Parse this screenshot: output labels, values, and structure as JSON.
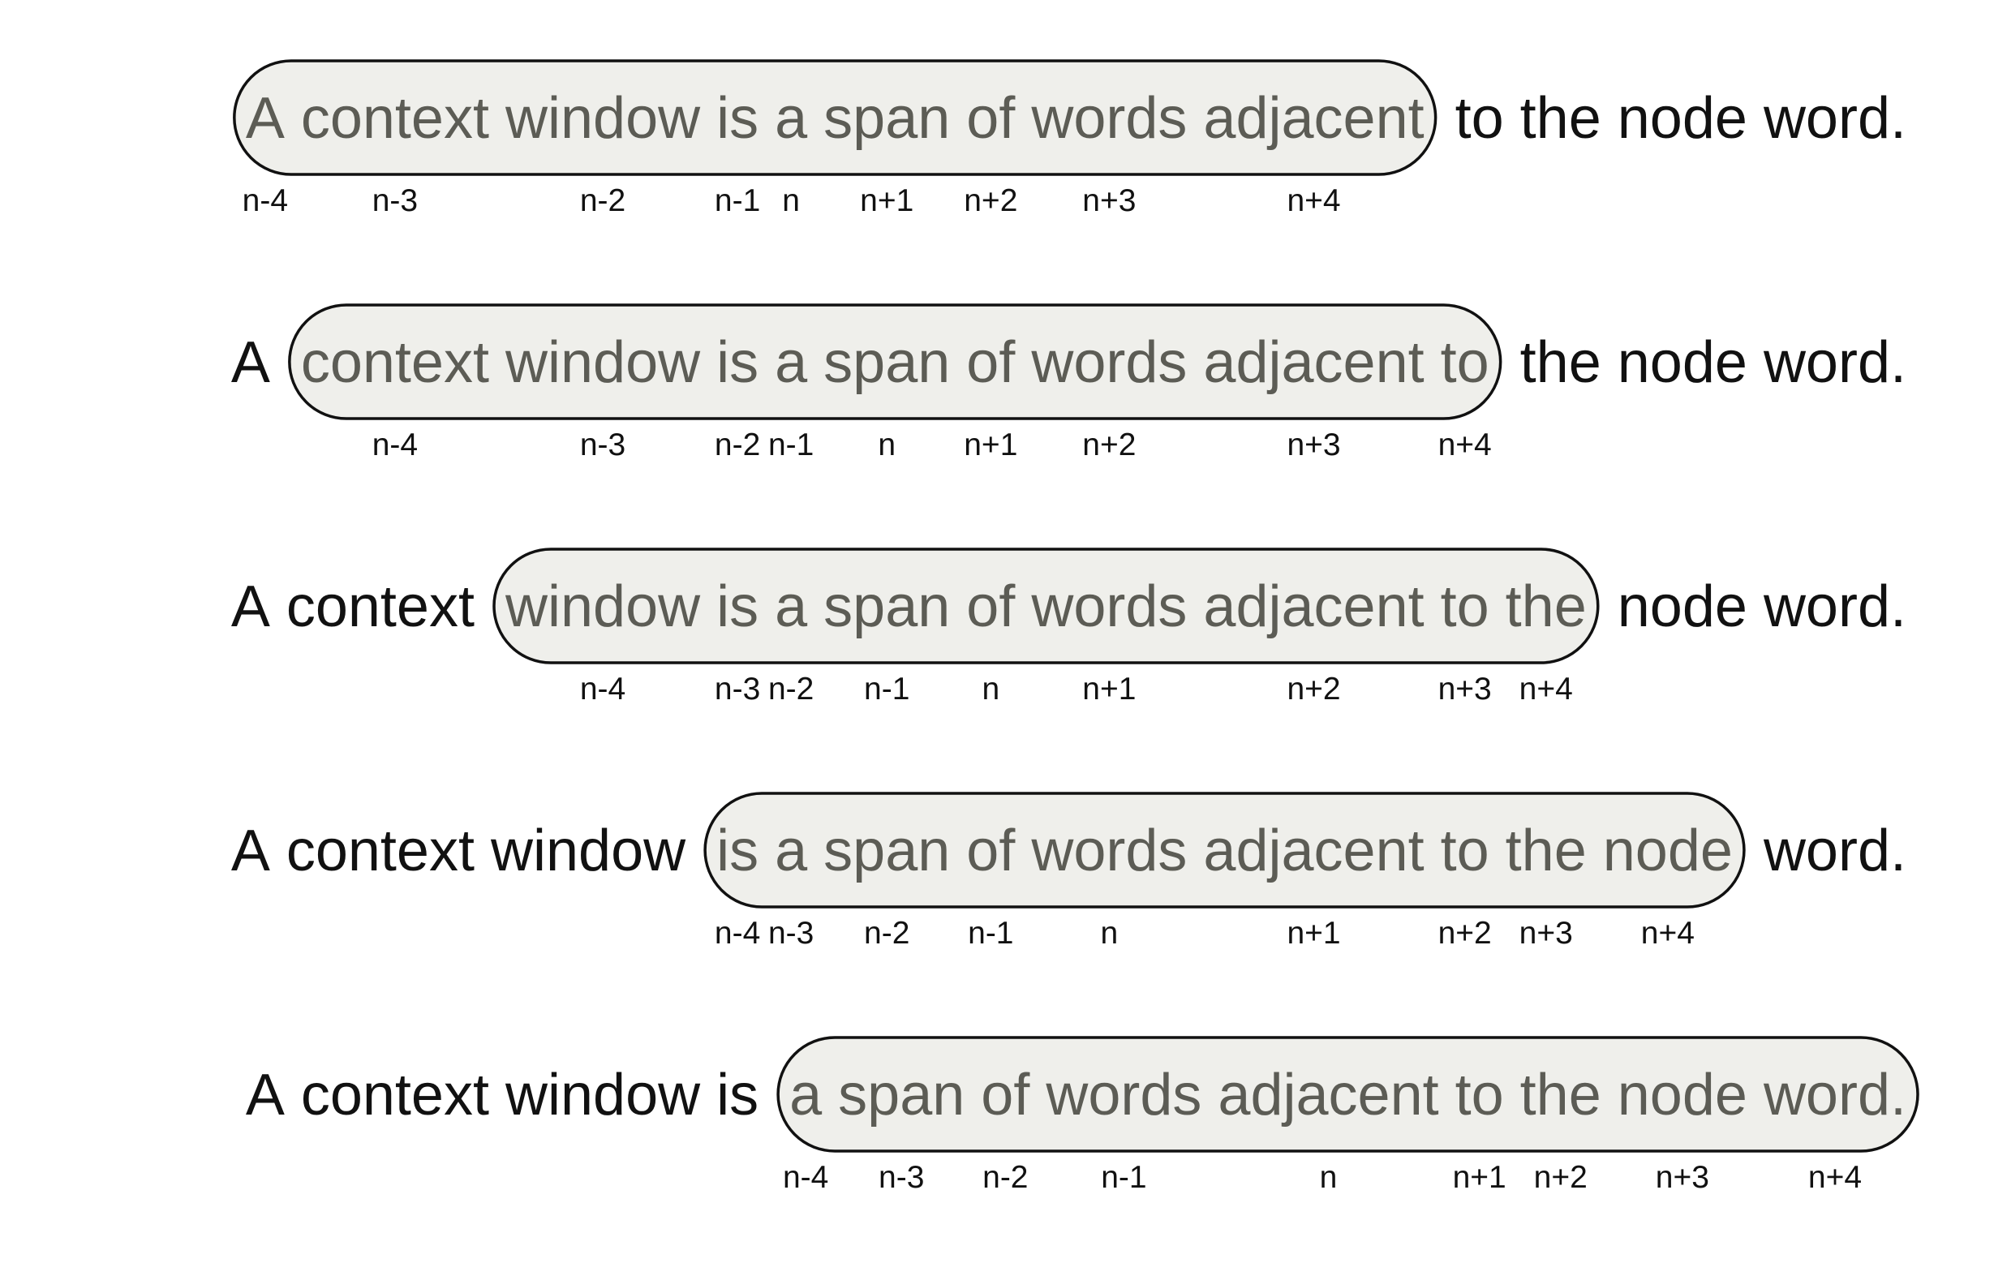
{
  "sentence": [
    "A",
    "context",
    "window",
    "is",
    "a",
    "span",
    "of",
    "words",
    "adjacent",
    "to",
    "the",
    "node",
    "word."
  ],
  "window_size": 9,
  "offset_labels": [
    "n-4",
    "n-3",
    "n-2",
    "n-1",
    "n",
    "n+1",
    "n+2",
    "n+3",
    "n+4"
  ],
  "rows": [
    {
      "window_start": 0
    },
    {
      "window_start": 1
    },
    {
      "window_start": 2
    },
    {
      "window_start": 3
    },
    {
      "window_start": 4
    }
  ],
  "colors": {
    "inside_text": "#5c5c55",
    "outside_text": "#111111",
    "window_fill": "#efefeb",
    "window_stroke": "#111111"
  }
}
